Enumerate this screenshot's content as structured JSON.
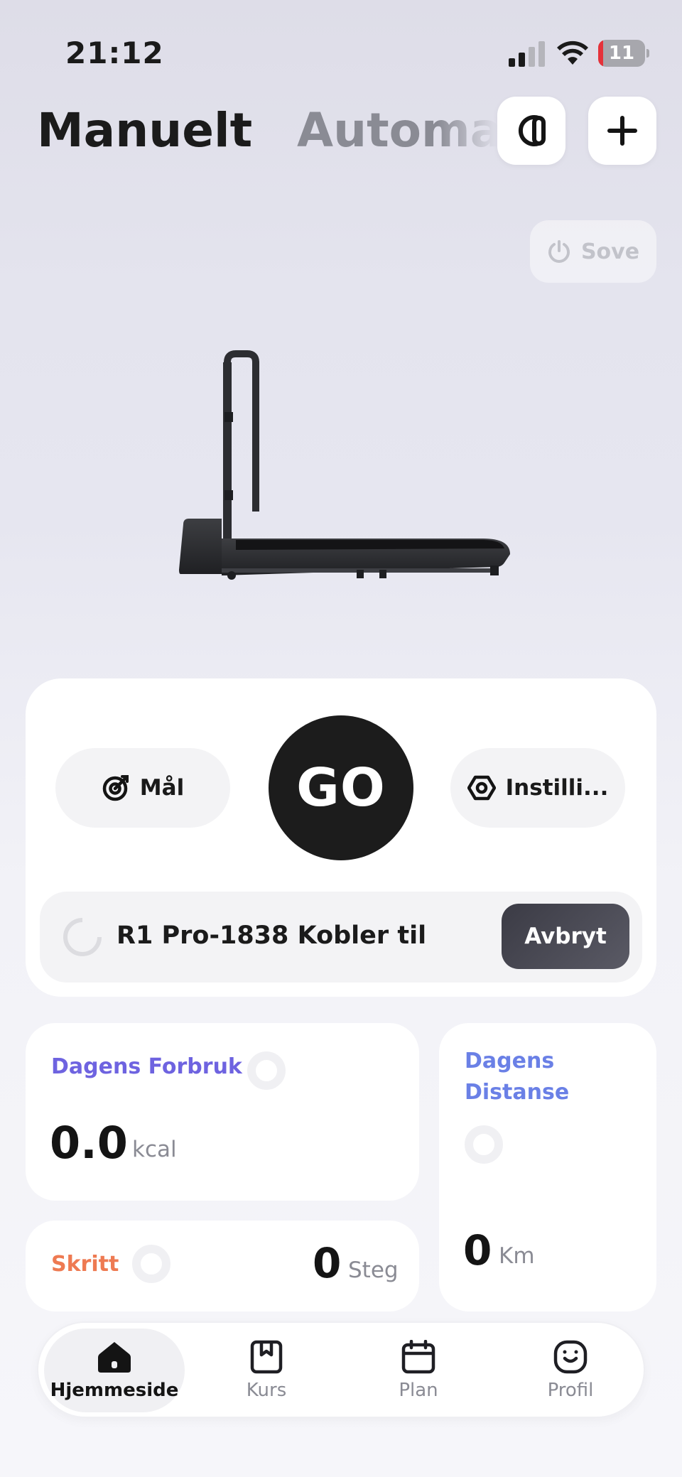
{
  "status_bar": {
    "time": "21:12",
    "battery_level": "11",
    "battery_fraction": 0.11,
    "battery_color": "#e5323a"
  },
  "header": {
    "tabs": [
      {
        "label": "Manuelt",
        "active": true
      },
      {
        "label": "Automatisk",
        "active": false
      }
    ],
    "device_button_icon": "treadmill-device-icon",
    "add_button_icon": "plus-icon",
    "sleep_button_label": "Sove",
    "sleep_icon": "power-icon"
  },
  "control": {
    "goal_label": "Mål",
    "goal_icon": "target-icon",
    "go_label": "GO",
    "settings_label": "Instilli...",
    "settings_icon": "hexagon-settings-icon",
    "connection_text": "R1 Pro-1838 Kobler til",
    "cancel_label": "Avbryt"
  },
  "stats": {
    "calories": {
      "title": "Dagens Forbruk",
      "value": "0.0",
      "unit": "kcal",
      "color": "#6e63e0"
    },
    "distance": {
      "title_line1": "Dagens",
      "title_line2": "Distanse",
      "value": "0",
      "unit": "Km",
      "color": "#6a80e6"
    },
    "steps": {
      "title": "Skritt",
      "value": "0",
      "unit": "Steg",
      "color": "#ee7a52"
    }
  },
  "nav": {
    "items": [
      {
        "label": "Hjemmeside",
        "icon": "home-icon",
        "active": true
      },
      {
        "label": "Kurs",
        "icon": "bookmark-book-icon",
        "active": false
      },
      {
        "label": "Plan",
        "icon": "calendar-icon",
        "active": false
      },
      {
        "label": "Profil",
        "icon": "smile-face-icon",
        "active": false
      }
    ]
  }
}
